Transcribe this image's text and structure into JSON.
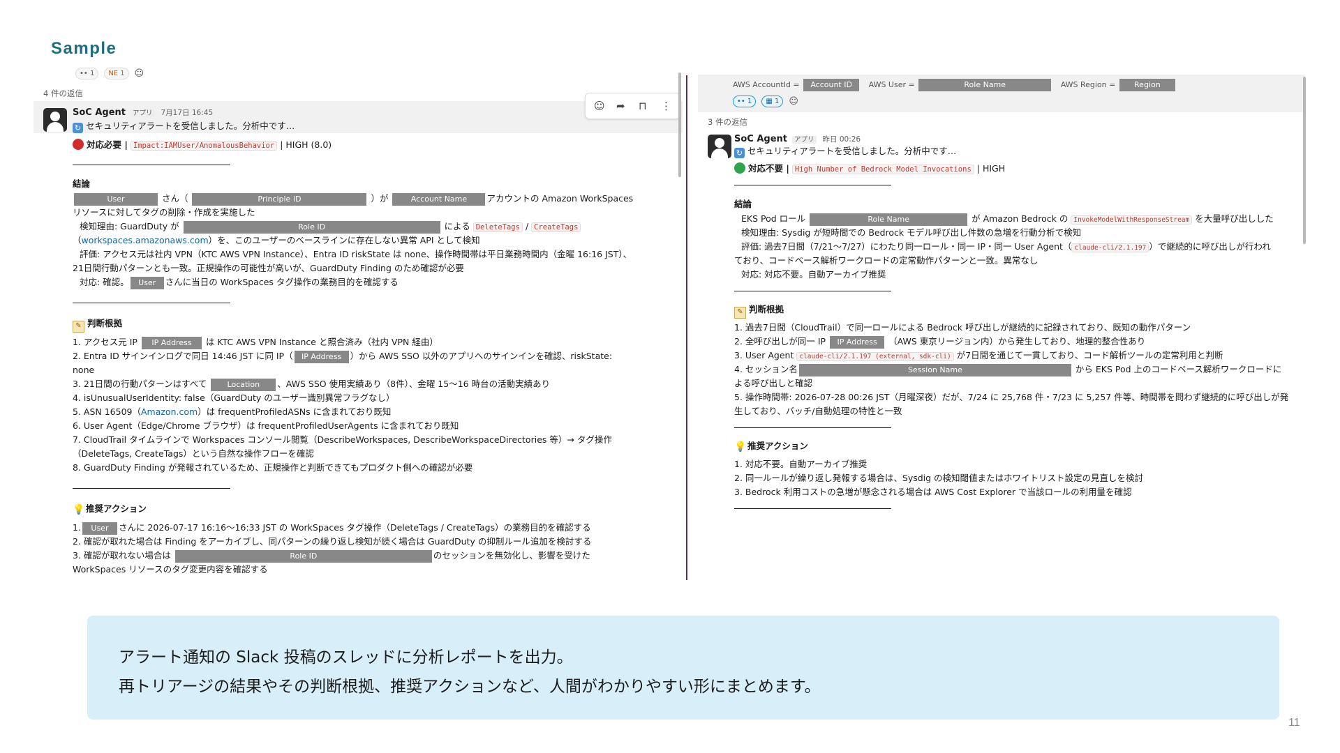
{
  "slide": {
    "title": "Sample",
    "caption_line1": "アラート通知の Slack 投稿のスレッドに分析レポートを出力。",
    "caption_line2": "再トリアージの結果やその判断根拠、推奨アクションなど、人間がわかりやすい形にまとめます。",
    "page_number": "11"
  },
  "left": {
    "top_reactions": {
      "r1": "•• 1",
      "r2": "NE 1"
    },
    "reply_count": "4 件の返信",
    "author": "SoC Agent",
    "app_tag": "アプリ",
    "time": "7月17日 16:45",
    "received": "セキュリティアラートを受信しました。分析中です…",
    "status_label": "対応必要 |",
    "finding_code": "Impact:IAMUser/AnomalousBehavior",
    "severity": "| HIGH (8.0)",
    "conclusion_heading": "結論",
    "redact": {
      "user": "User",
      "principal": "Principle ID",
      "account": "Account Name",
      "role": "Role ID",
      "ip": "IP Address",
      "location": "Location"
    },
    "c1_a": "さん（",
    "c1_b": "）が",
    "c1_c": "アカウントの Amazon WorkSpaces",
    "c2": "リソースに対してタグの削除・作成を実施した",
    "c3_a": "検知理由: GuardDuty が",
    "c3_b": "による",
    "code_delete": "DeleteTags",
    "code_slash": "/",
    "code_create": "CreateTags",
    "c4_a": "（",
    "c4_link": "workspaces.amazonaws.com",
    "c4_b": "）を、このユーザーのベースラインに存在しない異常 API として検知",
    "c5": "評価: アクセス元は社内 VPN（KTC AWS VPN Instance）、Entra ID riskState は none、操作時間帯は平日業務時間内（金曜 16:16 JST）、",
    "c6": "21日間行動パターンとも一致。正規操作の可能性が高いが、GuardDuty Finding のため確認が必要",
    "c7_a": "対応: 確認。",
    "c7_b": "さんに当日の WorkSpaces タグ操作の業務目的を確認する",
    "basis_heading": "判断根拠",
    "b1_a": "1. アクセス元 IP",
    "b1_b": "は KTC AWS VPN Instance と照合済み（社内 VPN 経由）",
    "b2_a": "2. Entra ID サインインログで同日 14:46 JST に同 IP（",
    "b2_b": "）から AWS SSO 以外のアプリへのサインインを確認、riskState:",
    "b2_c": "none",
    "b3_a": "3. 21日間の行動パターンはすべて",
    "b3_b": "、AWS SSO 使用実績あり（8件）、金曜 15〜16 時台の活動実績あり",
    "b4": "4. isUnusualUserIdentity: false（GuardDuty のユーザー識別異常フラグなし）",
    "b5_a": "5. ASN 16509（",
    "b5_link": "Amazon.com",
    "b5_b": "）は frequentProfiledASNs に含まれており既知",
    "b6": "6. User Agent（Edge/Chrome ブラウザ）は frequentProfiledUserAgents に含まれており既知",
    "b7": "7. CloudTrail タイムラインで Workspaces コンソール閲覧（DescribeWorkspaces, DescribeWorkspaceDirectories 等）→ タグ操作",
    "b7b": "（DeleteTags, CreateTags）という自然な操作フローを確認",
    "b8": "8. GuardDuty Finding が発報されているため、正規操作と判断できてもプロダクト側への確認が必要",
    "action_heading": "推奨アクション",
    "a1_a": "1.",
    "a1_b": "さんに 2026-07-17 16:16〜16:33 JST の WorkSpaces タグ操作（DeleteTags / CreateTags）の業務目的を確認する",
    "a2": "2. 確認が取れた場合は Finding をアーカイブし、同パターンの繰り返し検知が続く場合は GuardDuty の抑制ルール追加を検討する",
    "a3_a": "3. 確認が取れない場合は",
    "a3_b": "のセッションを無効化し、影響を受けた",
    "a3_c": "WorkSpaces リソースのタグ変更内容を確認する"
  },
  "right": {
    "h_account_label": "AWS AccountId =",
    "h_account": "Account ID",
    "h_user_label": "AWS User =",
    "h_user": "Role Name",
    "h_region_label": "AWS Region =",
    "h_region": "Region",
    "reactions": {
      "r1": "•• 1",
      "r2": "▦ 1"
    },
    "reply_count": "3 件の返信",
    "author": "SoC Agent",
    "app_tag": "アプリ",
    "time": "昨日 00:26",
    "received": "セキュリティアラートを受信しました。分析中です…",
    "status_label": "対応不要 |",
    "finding_code": "High Number of Bedrock Model Invocations",
    "severity": "| HIGH",
    "conclusion_heading": "結論",
    "redact": {
      "role": "Role Name",
      "ip": "IP Address",
      "session": "Session Name"
    },
    "c1_a": "EKS Pod ロール",
    "c1_b": "が Amazon Bedrock の",
    "c1_code": "InvokeModelWithResponseStream",
    "c1_c": "を大量呼び出しした",
    "c2": "検知理由: Sysdig が短時間での Bedrock モデル呼び出し件数の急増を行動分析で検知",
    "c3_a": "評価: 過去7日間（7/21〜7/27）にわたり同一ロール・同一 IP・同一 User Agent（",
    "c3_code": "claude-cli/2.1.197",
    "c3_b": "）で継続的に呼び出しが行われ",
    "c4": "ており、コードベース解析ワークロードの定常動作パターンと一致。異常なし",
    "c5": "対応: 対応不要。自動アーカイブ推奨",
    "basis_heading": "判断根拠",
    "b1": "1. 過去7日間（CloudTrail）で同一ロールによる Bedrock 呼び出しが継続的に記録されており、既知の動作パターン",
    "b2_a": "2. 全呼び出しが同一 IP",
    "b2_b": "（AWS 東京リージョン内）から発生しており、地理的整合性あり",
    "b3_a": "3. User Agent",
    "b3_code": "claude-cli/2.1.197 (external, sdk-cli)",
    "b3_b": "が7日間を通じて一貫しており、コード解析ツールの定常利用と判断",
    "b4_a": "4. セッション名",
    "b4_b": "から EKS Pod 上のコードベース解析ワークロードに",
    "b4_c": "よる呼び出しと確認",
    "b5": "5. 操作時間帯: 2026-07-28 00:26 JST（月曜深夜）だが、7/24 に 25,768 件・7/23 に 5,257 件等、時間帯を問わず継続的に呼び出しが発",
    "b5b": "生しており、バッチ/自動処理の特性と一致",
    "action_heading": "推奨アクション",
    "a1": "1. 対応不要。自動アーカイブ推奨",
    "a2": "2. 同一ルールが繰り返し発報する場合は、Sysdig の検知閾値またはホワイトリスト設定の見直しを検討",
    "a3": "3. Bedrock 利用コストの急増が懸念される場合は AWS Cost Explorer で当該ロールの利用量を確認"
  }
}
